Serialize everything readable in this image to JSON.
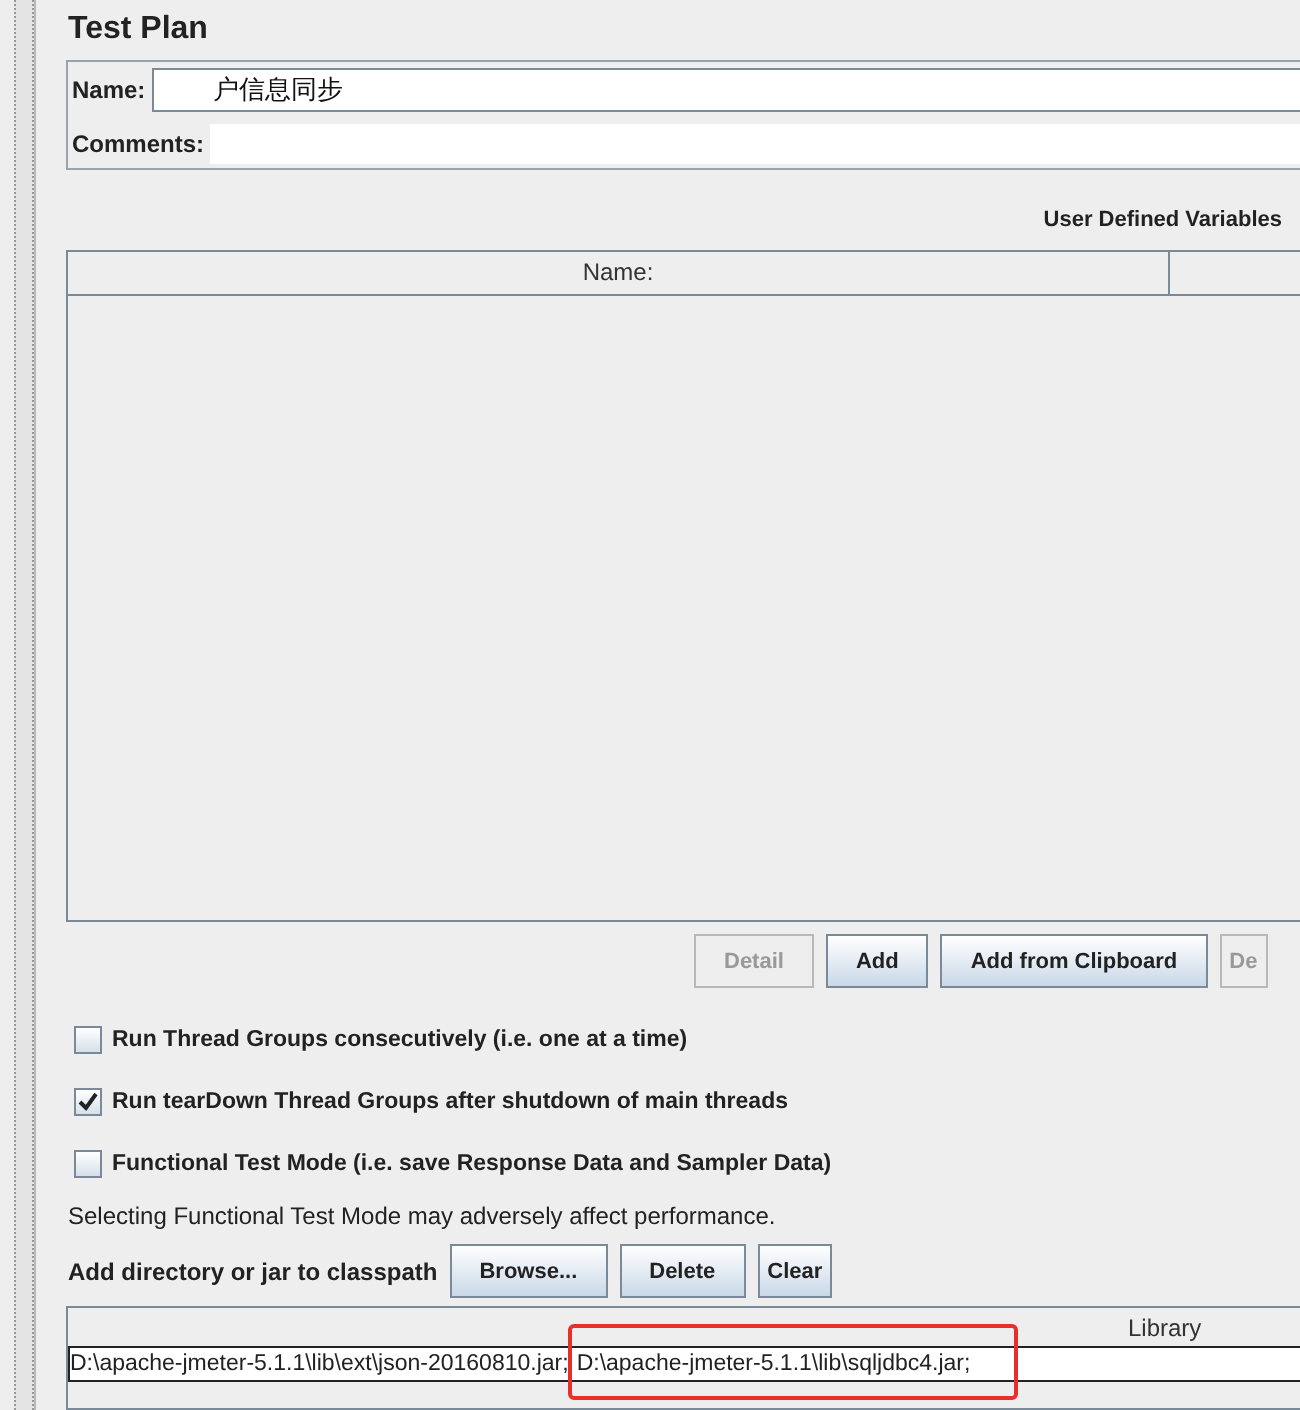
{
  "panel": {
    "title": "Test Plan"
  },
  "name_field": {
    "label": "Name:",
    "value": "户信息同步"
  },
  "comments_field": {
    "label": "Comments:"
  },
  "variables": {
    "title": "User Defined Variables",
    "columns": [
      "Name:"
    ],
    "buttons": [
      {
        "label": "Detail",
        "disabled": true
      },
      {
        "label": "Add",
        "disabled": false
      },
      {
        "label": "Add from Clipboard",
        "disabled": false
      },
      {
        "label": "De",
        "disabled": true
      }
    ]
  },
  "options": [
    {
      "label": "Run Thread Groups consecutively (i.e. one at a time)",
      "checked": false
    },
    {
      "label": "Run tearDown Thread Groups after shutdown of main threads",
      "checked": true
    },
    {
      "label": "Functional Test Mode (i.e. save Response Data and Sampler Data)",
      "checked": false
    }
  ],
  "note": "Selecting Functional Test Mode may adversely affect performance.",
  "classpath": {
    "label": "Add directory or jar to classpath",
    "buttons": [
      "Browse...",
      "Delete",
      "Clear"
    ],
    "columns": [
      "Library"
    ],
    "rows": [
      {
        "entries": [
          {
            "text": "D:\\apache-jmeter-5.1.1\\lib\\ext\\json-20160810.jar;",
            "highlighted": false
          },
          {
            "text": "D:\\apache-jmeter-5.1.1\\lib\\sqljdbc4.jar;",
            "highlighted": true
          }
        ]
      }
    ]
  }
}
